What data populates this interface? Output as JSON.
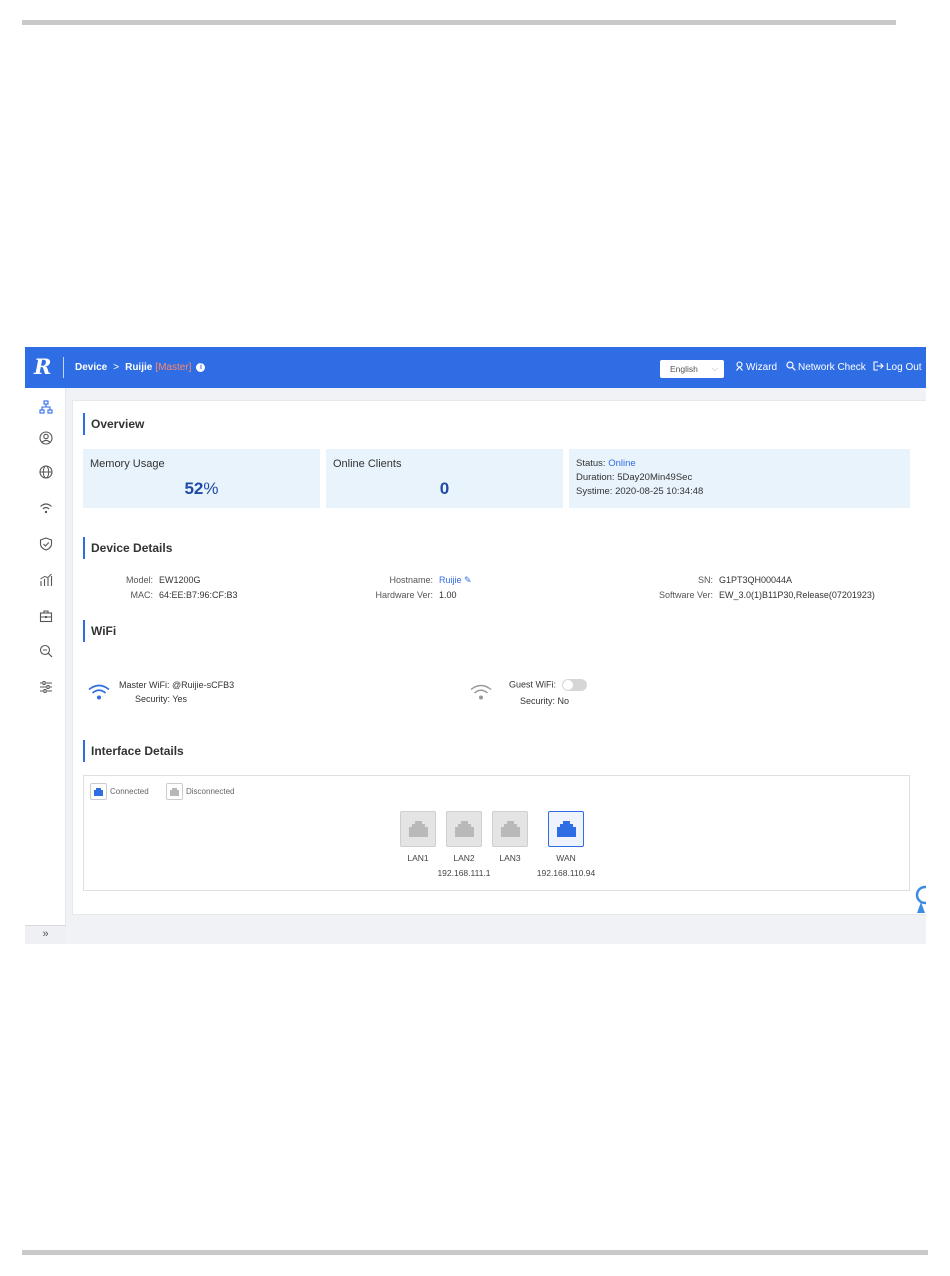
{
  "header": {
    "logo": "R",
    "breadcrumb_device": "Device",
    "breadcrumb_chevron": ">",
    "breadcrumb_host": "Ruijie",
    "breadcrumb_role": "[Master]",
    "info_icon": "i",
    "language": "English",
    "wizard": "Wizard",
    "network_check": "Network Check",
    "logout": "Log Out"
  },
  "sidebar": {
    "items": [
      "network-topology-icon",
      "user-circle-icon",
      "globe-icon",
      "wifi-icon",
      "shield-check-icon",
      "chart-icon",
      "toolbox-icon",
      "search-zoom-icon",
      "settings-sliders-icon"
    ],
    "expand": "»"
  },
  "overview": {
    "title": "Overview",
    "memory_label": "Memory Usage",
    "memory_value": "52",
    "memory_unit": "%",
    "clients_label": "Online Clients",
    "clients_value": "0",
    "status_label": "Status:",
    "status_value": "Online",
    "duration_label": "Duration:",
    "duration_value": "5Day20Min49Sec",
    "systime_label": "Systime:",
    "systime_value": "2020-08-25 10:34:48"
  },
  "device_details": {
    "title": "Device Details",
    "model_label": "Model:",
    "model_value": "EW1200G",
    "mac_label": "MAC:",
    "mac_value": "64:EE:B7:96:CF:B3",
    "hostname_label": "Hostname:",
    "hostname_value": "Ruijie",
    "hardware_label": "Hardware Ver:",
    "hardware_value": "1.00",
    "sn_label": "SN:",
    "sn_value": "G1PT3QH00044A",
    "software_label": "Software Ver:",
    "software_value": "EW_3.0(1)B11P30,Release(07201923)"
  },
  "wifi": {
    "title": "WiFi",
    "master_label": "Master WiFi:",
    "master_ssid": "@Ruijie-sCFB3",
    "master_security_label": "Security:",
    "master_security_value": "Yes",
    "guest_label": "Guest WiFi:",
    "guest_security_label": "Security:",
    "guest_security_value": "No"
  },
  "interfaces": {
    "title": "Interface Details",
    "legend_connected": "Connected",
    "legend_disconnected": "Disconnected",
    "ports": [
      {
        "name": "LAN1",
        "connected": false
      },
      {
        "name": "LAN2",
        "connected": false
      },
      {
        "name": "LAN3",
        "connected": false
      },
      {
        "name": "WAN",
        "connected": true
      }
    ],
    "lan_ip": "192.168.111.1",
    "wan_ip": "192.168.110.94"
  },
  "colors": {
    "brand": "#2f6de5",
    "card_bg": "#e8f3fc",
    "metric_text": "#1f4aa8",
    "master_role": "#ff8a65"
  }
}
